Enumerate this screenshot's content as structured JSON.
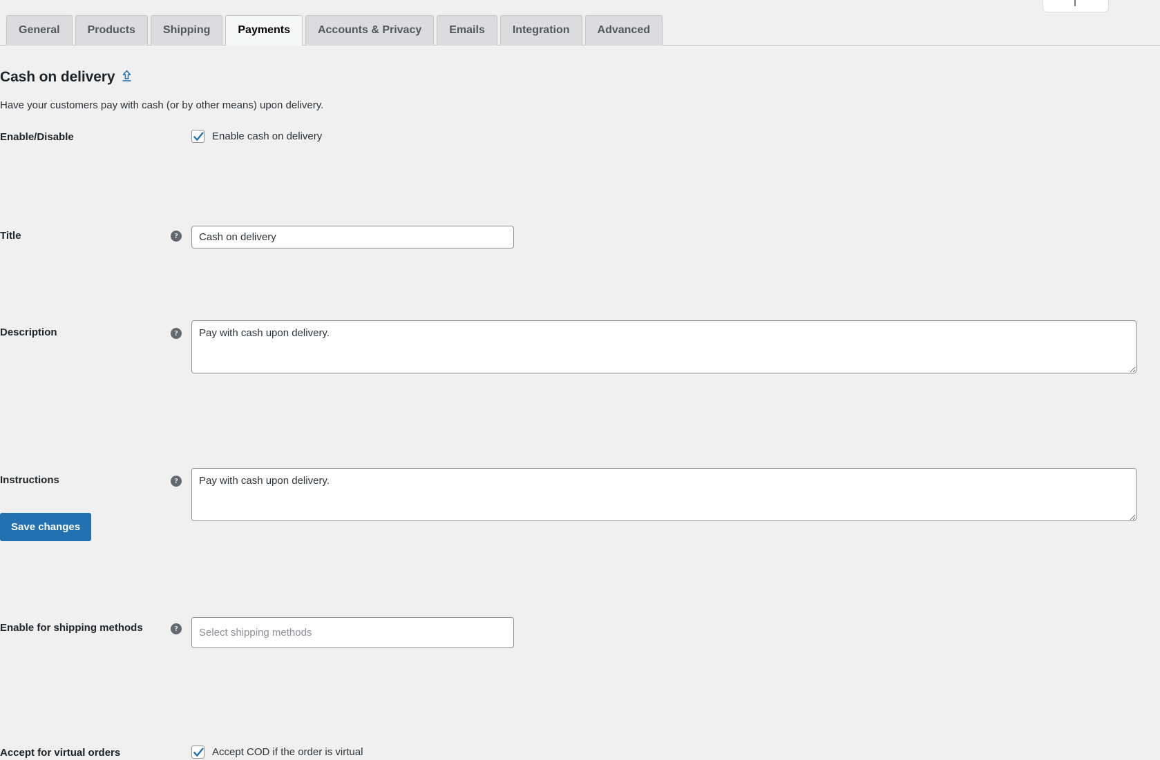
{
  "tabs": [
    {
      "label": "General",
      "active": false
    },
    {
      "label": "Products",
      "active": false
    },
    {
      "label": "Shipping",
      "active": false
    },
    {
      "label": "Payments",
      "active": true
    },
    {
      "label": "Accounts & Privacy",
      "active": false
    },
    {
      "label": "Emails",
      "active": false
    },
    {
      "label": "Integration",
      "active": false
    },
    {
      "label": "Advanced",
      "active": false
    }
  ],
  "page": {
    "title": "Cash on delivery",
    "back_link_title": "Return to payments",
    "description": "Have your customers pay with cash (or by other means) upon delivery."
  },
  "fields": {
    "enable": {
      "label": "Enable/Disable",
      "checkbox_label": "Enable cash on delivery",
      "checked": true
    },
    "title": {
      "label": "Title",
      "help": "?",
      "value": "Cash on delivery",
      "placeholder": ""
    },
    "description": {
      "label": "Description",
      "help": "?",
      "value": "Pay with cash upon delivery.",
      "placeholder": ""
    },
    "instructions": {
      "label": "Instructions",
      "help": "?",
      "value": "Pay with cash upon delivery.",
      "placeholder": ""
    },
    "shipping_methods": {
      "label": "Enable for shipping methods",
      "help": "?",
      "value": "",
      "placeholder": "Select shipping methods"
    },
    "virtual_orders": {
      "label": "Accept for virtual orders",
      "checkbox_label": "Accept COD if the order is virtual",
      "checked": true
    }
  },
  "actions": {
    "save_label": "Save changes"
  },
  "colors": {
    "accent": "#2271b1",
    "page_bg": "#f0f0f1",
    "tab_inactive_bg": "#dcdcde",
    "tab_active_bg": "#f6f7f7",
    "border": "#8c8f94",
    "help_icon_bg": "#646970"
  }
}
